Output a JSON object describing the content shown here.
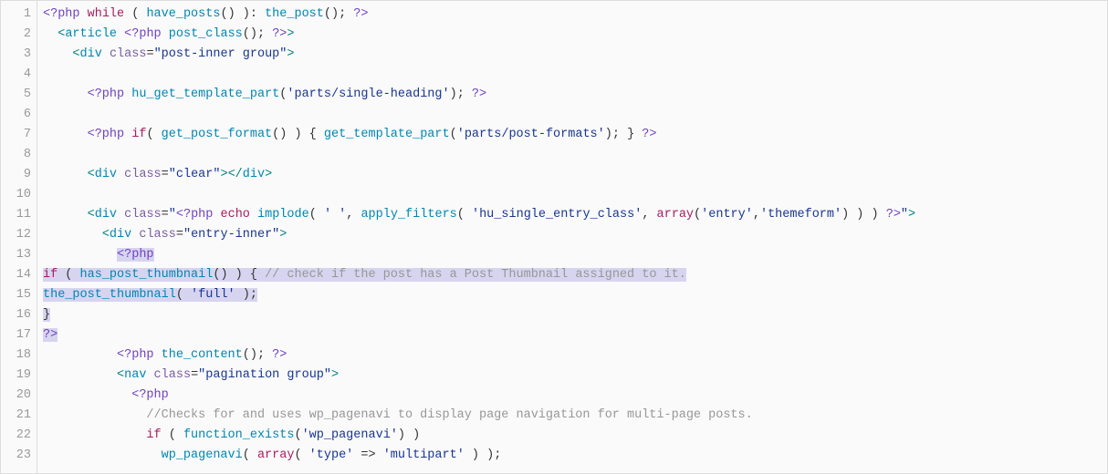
{
  "gutter": {
    "lines": [
      "1",
      "2",
      "3",
      "4",
      "5",
      "6",
      "7",
      "8",
      "9",
      "10",
      "11",
      "12",
      "13",
      "14",
      "15",
      "16",
      "17",
      "18",
      "19",
      "20",
      "21",
      "22",
      "23"
    ]
  },
  "code": {
    "lines": [
      {
        "hl": false,
        "tokens": [
          [
            "t-meta",
            "<?php"
          ],
          [
            "t-punc",
            " "
          ],
          [
            "t-kw",
            "while"
          ],
          [
            "t-punc",
            " ( "
          ],
          [
            "t-fn",
            "have_posts"
          ],
          [
            "t-punc",
            "() ): "
          ],
          [
            "t-fn",
            "the_post"
          ],
          [
            "t-punc",
            "(); "
          ],
          [
            "t-meta",
            "?>"
          ]
        ]
      },
      {
        "hl": false,
        "tokens": [
          [
            "t-punc",
            "  "
          ],
          [
            "t-br",
            "<"
          ],
          [
            "t-tag",
            "article"
          ],
          [
            "t-punc",
            " "
          ],
          [
            "t-meta",
            "<?php"
          ],
          [
            "t-punc",
            " "
          ],
          [
            "t-fn",
            "post_class"
          ],
          [
            "t-punc",
            "(); "
          ],
          [
            "t-meta",
            "?>"
          ],
          [
            "t-br",
            ">"
          ]
        ]
      },
      {
        "hl": false,
        "tokens": [
          [
            "t-punc",
            "    "
          ],
          [
            "t-br",
            "<"
          ],
          [
            "t-tag",
            "div"
          ],
          [
            "t-punc",
            " "
          ],
          [
            "t-attr",
            "class"
          ],
          [
            "t-punc",
            "="
          ],
          [
            "t-str",
            "\"post-inner group\""
          ],
          [
            "t-br",
            ">"
          ]
        ]
      },
      {
        "hl": false,
        "tokens": [
          [
            "t-punc",
            ""
          ]
        ]
      },
      {
        "hl": false,
        "tokens": [
          [
            "t-punc",
            "      "
          ],
          [
            "t-meta",
            "<?php"
          ],
          [
            "t-punc",
            " "
          ],
          [
            "t-fn",
            "hu_get_template_part"
          ],
          [
            "t-punc",
            "("
          ],
          [
            "t-str",
            "'parts/single-heading'"
          ],
          [
            "t-punc",
            "); "
          ],
          [
            "t-meta",
            "?>"
          ]
        ]
      },
      {
        "hl": false,
        "tokens": [
          [
            "t-punc",
            ""
          ]
        ]
      },
      {
        "hl": false,
        "tokens": [
          [
            "t-punc",
            "      "
          ],
          [
            "t-meta",
            "<?php"
          ],
          [
            "t-punc",
            " "
          ],
          [
            "t-kw",
            "if"
          ],
          [
            "t-punc",
            "( "
          ],
          [
            "t-fn",
            "get_post_format"
          ],
          [
            "t-punc",
            "() ) { "
          ],
          [
            "t-fn",
            "get_template_part"
          ],
          [
            "t-punc",
            "("
          ],
          [
            "t-str",
            "'parts/post-formats'"
          ],
          [
            "t-punc",
            "); } "
          ],
          [
            "t-meta",
            "?>"
          ]
        ]
      },
      {
        "hl": false,
        "tokens": [
          [
            "t-punc",
            ""
          ]
        ]
      },
      {
        "hl": false,
        "tokens": [
          [
            "t-punc",
            "      "
          ],
          [
            "t-br",
            "<"
          ],
          [
            "t-tag",
            "div"
          ],
          [
            "t-punc",
            " "
          ],
          [
            "t-attr",
            "class"
          ],
          [
            "t-punc",
            "="
          ],
          [
            "t-str",
            "\"clear\""
          ],
          [
            "t-br",
            "></"
          ],
          [
            "t-tag",
            "div"
          ],
          [
            "t-br",
            ">"
          ]
        ]
      },
      {
        "hl": false,
        "tokens": [
          [
            "t-punc",
            ""
          ]
        ]
      },
      {
        "hl": false,
        "tokens": [
          [
            "t-punc",
            "      "
          ],
          [
            "t-br",
            "<"
          ],
          [
            "t-tag",
            "div"
          ],
          [
            "t-punc",
            " "
          ],
          [
            "t-attr",
            "class"
          ],
          [
            "t-punc",
            "="
          ],
          [
            "t-str",
            "\""
          ],
          [
            "t-meta",
            "<?php"
          ],
          [
            "t-punc",
            " "
          ],
          [
            "t-kw",
            "echo"
          ],
          [
            "t-punc",
            " "
          ],
          [
            "t-fn",
            "implode"
          ],
          [
            "t-punc",
            "( "
          ],
          [
            "t-str",
            "' '"
          ],
          [
            "t-punc",
            ", "
          ],
          [
            "t-fn",
            "apply_filters"
          ],
          [
            "t-punc",
            "( "
          ],
          [
            "t-str",
            "'hu_single_entry_class'"
          ],
          [
            "t-punc",
            ", "
          ],
          [
            "t-kw",
            "array"
          ],
          [
            "t-punc",
            "("
          ],
          [
            "t-str",
            "'entry'"
          ],
          [
            "t-punc",
            ","
          ],
          [
            "t-str",
            "'themeform'"
          ],
          [
            "t-punc",
            ") ) ) "
          ],
          [
            "t-meta",
            "?>"
          ],
          [
            "t-str",
            "\""
          ],
          [
            "t-br",
            ">"
          ]
        ]
      },
      {
        "hl": false,
        "tokens": [
          [
            "t-punc",
            "        "
          ],
          [
            "t-br",
            "<"
          ],
          [
            "t-tag",
            "div"
          ],
          [
            "t-punc",
            " "
          ],
          [
            "t-attr",
            "class"
          ],
          [
            "t-punc",
            "="
          ],
          [
            "t-str",
            "\"entry-inner\""
          ],
          [
            "t-br",
            ">"
          ]
        ]
      },
      {
        "hl": false,
        "tokens": [
          [
            "t-punc",
            "          "
          ]
        ],
        "trailing_hl": [
          [
            "t-meta",
            "<?php"
          ]
        ]
      },
      {
        "hl": true,
        "tokens": [
          [
            "t-kw",
            "if"
          ],
          [
            "t-punc",
            " ( "
          ],
          [
            "t-fn",
            "has_post_thumbnail"
          ],
          [
            "t-punc",
            "() ) { "
          ],
          [
            "t-comm",
            "// check if the post has a Post Thumbnail assigned to it."
          ]
        ]
      },
      {
        "hl": true,
        "tokens": [
          [
            "t-fn",
            "the_post_thumbnail"
          ],
          [
            "t-punc",
            "( "
          ],
          [
            "t-str",
            "'full'"
          ],
          [
            "t-punc",
            " );"
          ]
        ]
      },
      {
        "hl": true,
        "tokens": [
          [
            "t-punc",
            "}"
          ]
        ]
      },
      {
        "hl": true,
        "tokens": [
          [
            "t-meta",
            "?>"
          ]
        ]
      },
      {
        "hl": false,
        "tokens": [
          [
            "t-punc",
            "          "
          ],
          [
            "t-meta",
            "<?php"
          ],
          [
            "t-punc",
            " "
          ],
          [
            "t-fn",
            "the_content"
          ],
          [
            "t-punc",
            "(); "
          ],
          [
            "t-meta",
            "?>"
          ]
        ]
      },
      {
        "hl": false,
        "tokens": [
          [
            "t-punc",
            "          "
          ],
          [
            "t-br",
            "<"
          ],
          [
            "t-tag",
            "nav"
          ],
          [
            "t-punc",
            " "
          ],
          [
            "t-attr",
            "class"
          ],
          [
            "t-punc",
            "="
          ],
          [
            "t-str",
            "\"pagination group\""
          ],
          [
            "t-br",
            ">"
          ]
        ]
      },
      {
        "hl": false,
        "tokens": [
          [
            "t-punc",
            "            "
          ],
          [
            "t-meta",
            "<?php"
          ]
        ]
      },
      {
        "hl": false,
        "tokens": [
          [
            "t-punc",
            "              "
          ],
          [
            "t-comm",
            "//Checks for and uses wp_pagenavi to display page navigation for multi-page posts."
          ]
        ]
      },
      {
        "hl": false,
        "tokens": [
          [
            "t-punc",
            "              "
          ],
          [
            "t-kw",
            "if"
          ],
          [
            "t-punc",
            " ( "
          ],
          [
            "t-fn",
            "function_exists"
          ],
          [
            "t-punc",
            "("
          ],
          [
            "t-str",
            "'wp_pagenavi'"
          ],
          [
            "t-punc",
            ") )"
          ]
        ]
      },
      {
        "hl": false,
        "tokens": [
          [
            "t-punc",
            "                "
          ],
          [
            "t-fn",
            "wp_pagenavi"
          ],
          [
            "t-punc",
            "( "
          ],
          [
            "t-kw",
            "array"
          ],
          [
            "t-punc",
            "( "
          ],
          [
            "t-str",
            "'type'"
          ],
          [
            "t-punc",
            " => "
          ],
          [
            "t-str",
            "'multipart'"
          ],
          [
            "t-punc",
            " ) );"
          ]
        ]
      }
    ]
  },
  "chart_data": null
}
